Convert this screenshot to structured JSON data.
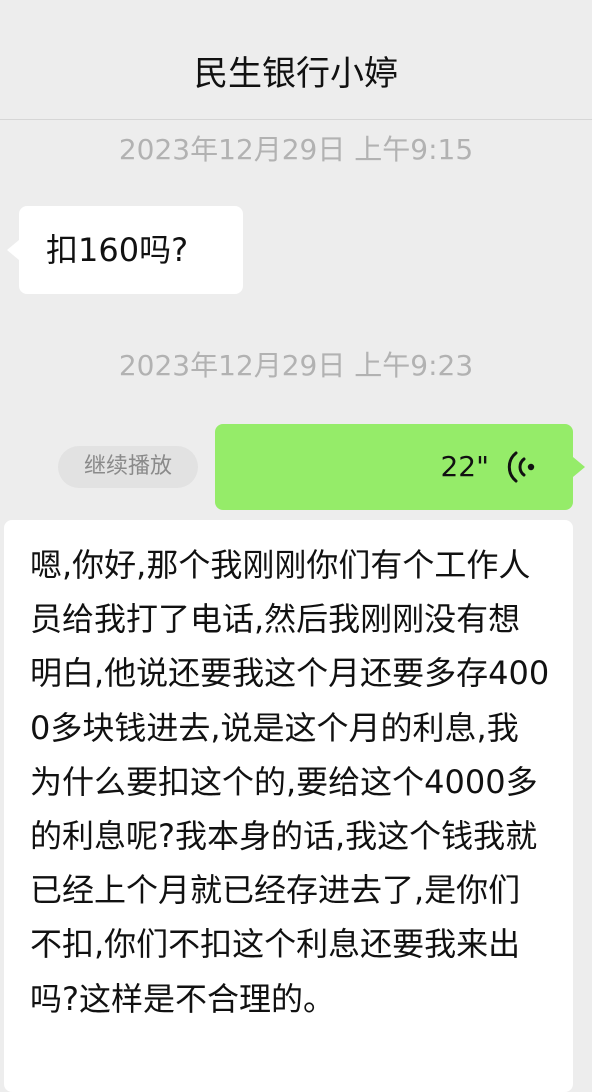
{
  "header": {
    "title": "民生银行小婷"
  },
  "messages": [
    {
      "timestamp": "2023年12月29日 上午9:15",
      "text": "扣160吗?"
    },
    {
      "timestamp": "2023年12月29日 上午9:23",
      "voice_duration": "22\"",
      "resume_label": "继续播放",
      "icon": "voice-playing-icon",
      "transcript": "嗯,你好,那个我刚刚你们有个工作人员给我打了电话,然后我刚刚没有想明白,他说还要我这个月还要多存4000多块钱进去,说是这个月的利息,我为什么要扣这个的,要给这个4000多的利息呢?我本身的话,我这个钱我就已经上个月就已经存进去了,是你们不扣,你们不扣这个利息还要我来出吗?这样是不合理的。"
    }
  ],
  "colors": {
    "background": "#ededed",
    "incoming_bubble": "#ffffff",
    "outgoing_bubble": "#95ec69",
    "timestamp_text": "#b2b2b2"
  }
}
